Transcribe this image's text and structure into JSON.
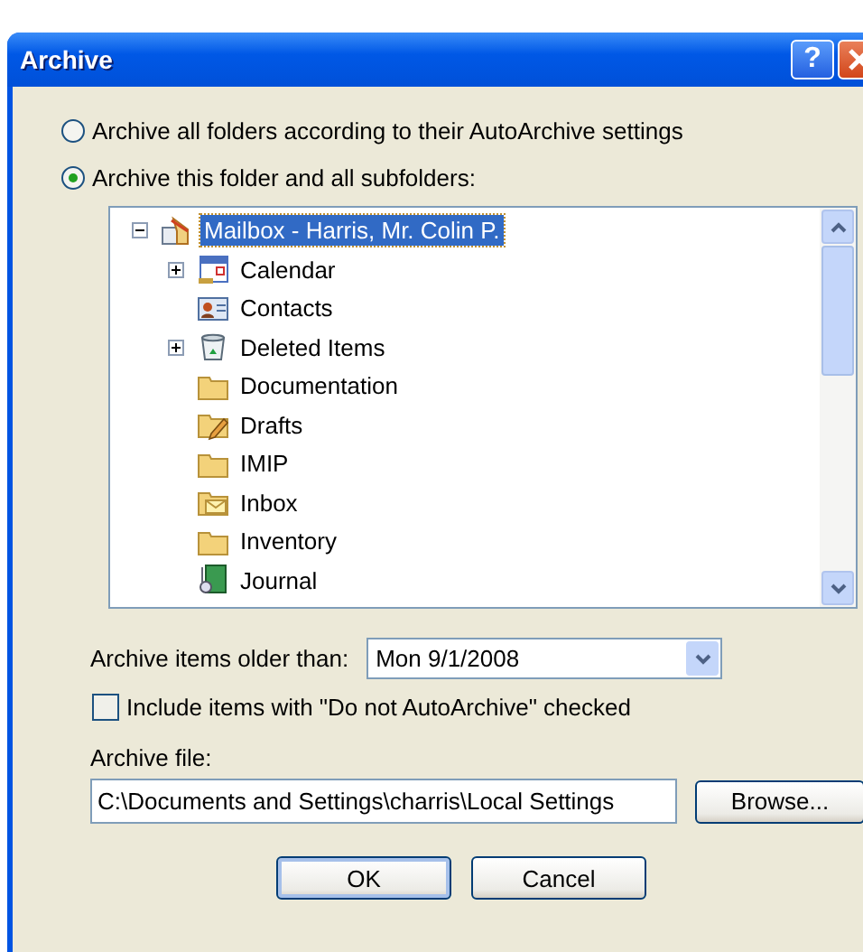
{
  "window": {
    "title": "Archive",
    "title_buttons": [
      {
        "kind": "help",
        "label": "?"
      },
      {
        "kind": "close"
      }
    ]
  },
  "options": [
    {
      "label": "Archive all folders according to their AutoArchive settings",
      "selected": false
    },
    {
      "label": "Archive this folder and all subfolders:",
      "selected": true
    }
  ],
  "tree": [
    {
      "label": "Mailbox - Harris, Mr. Colin P.",
      "kind": "mailbox",
      "selected": true,
      "expanded": true,
      "children": [
        {
          "label": "Calendar",
          "kind": "calendar",
          "selected": false,
          "expanded": false
        },
        {
          "label": "Contacts",
          "kind": "contacts",
          "selected": false
        },
        {
          "label": "Deleted Items",
          "kind": "trash",
          "selected": false,
          "expanded": false
        },
        {
          "label": "Documentation",
          "kind": "folder",
          "selected": false
        },
        {
          "label": "Drafts",
          "kind": "drafts",
          "selected": false
        },
        {
          "label": "IMIP",
          "kind": "folder",
          "selected": false
        },
        {
          "label": "Inbox",
          "kind": "inbox",
          "selected": false
        },
        {
          "label": "Inventory",
          "kind": "folder",
          "selected": false
        },
        {
          "label": "Journal",
          "kind": "journal",
          "selected": false
        }
      ]
    }
  ],
  "older_than": {
    "label": "Archive items older than:",
    "value": "Mon 9/1/2008"
  },
  "include_checkbox": {
    "label": "Include items with \"Do not AutoArchive\" checked",
    "checked": false
  },
  "archive_file": {
    "label": "Archive file:",
    "value": "C:\\Documents and Settings\\charris\\Local Settings",
    "button": "Browse..."
  },
  "buttons": [
    {
      "label": "OK",
      "default": true
    },
    {
      "label": "Cancel",
      "default": false
    }
  ]
}
